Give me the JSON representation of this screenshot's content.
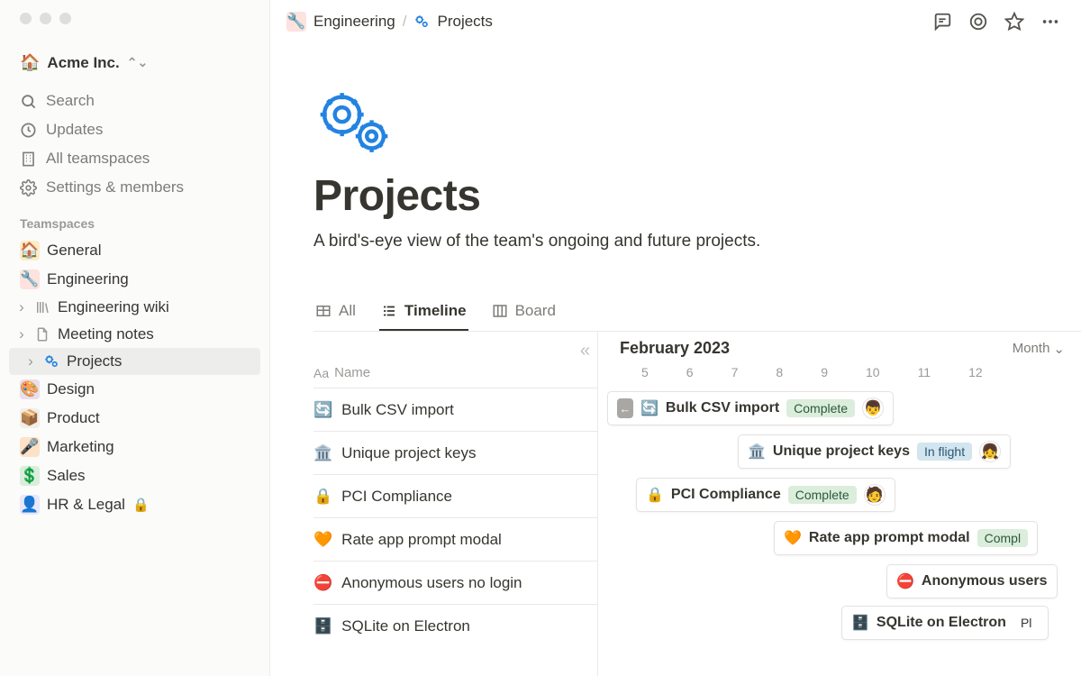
{
  "workspace": {
    "name": "Acme Inc."
  },
  "sidebar_nav": {
    "search": "Search",
    "updates": "Updates",
    "teamspaces": "All teamspaces",
    "settings": "Settings & members"
  },
  "sidebar_section": "Teamspaces",
  "teamspaces": {
    "general": "General",
    "engineering": "Engineering",
    "engineering_wiki": "Engineering wiki",
    "meeting_notes": "Meeting notes",
    "projects": "Projects",
    "design": "Design",
    "product": "Product",
    "marketing": "Marketing",
    "sales": "Sales",
    "hr_legal": "HR & Legal"
  },
  "breadcrumb": {
    "parent": "Engineering",
    "current": "Projects"
  },
  "page": {
    "title": "Projects",
    "subtitle": "A bird's-eye view of the team's ongoing and future projects."
  },
  "views": {
    "all": "All",
    "timeline": "Timeline",
    "board": "Board"
  },
  "timeline": {
    "month_label": "February 2023",
    "scale_label": "Month",
    "name_col_label": "Name",
    "name_col_prefix": "Aa",
    "days": [
      "5",
      "6",
      "7",
      "8",
      "9",
      "10",
      "11",
      "12"
    ]
  },
  "rows": [
    {
      "emoji": "🔄",
      "name": "Bulk CSV import"
    },
    {
      "emoji": "🏛️",
      "name": "Unique project keys"
    },
    {
      "emoji": "🔒",
      "name": "PCI Compliance"
    },
    {
      "emoji": "🧡",
      "name": "Rate app prompt modal"
    },
    {
      "emoji": "⛔",
      "name": "Anonymous users no login"
    },
    {
      "emoji": "🗄️",
      "name": "SQLite on Electron"
    }
  ],
  "bars": [
    {
      "emoji": "🔄",
      "name": "Bulk CSV import",
      "status": "Complete",
      "status_class": "pill-complete",
      "avatar": "👦",
      "handle": true
    },
    {
      "emoji": "🏛️",
      "name": "Unique project keys",
      "status": "In flight",
      "status_class": "pill-inflight",
      "avatar": "👧"
    },
    {
      "emoji": "🔒",
      "name": "PCI Compliance",
      "status": "Complete",
      "status_class": "pill-complete",
      "avatar": "🧑"
    },
    {
      "emoji": "🧡",
      "name": "Rate app prompt modal",
      "status": "Compl",
      "status_class": "pill-complete"
    },
    {
      "emoji": "⛔",
      "name": "Anonymous users"
    },
    {
      "emoji": "🗄️",
      "name": "SQLite on Electron",
      "status": "Pl"
    }
  ]
}
